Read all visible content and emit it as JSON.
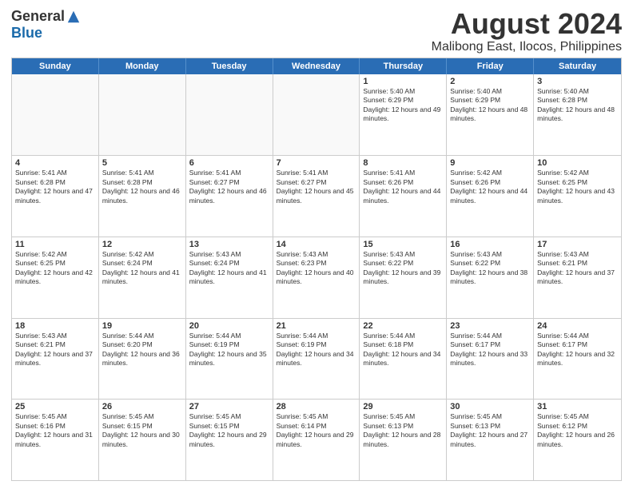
{
  "logo": {
    "general": "General",
    "blue": "Blue"
  },
  "title": "August 2024",
  "subtitle": "Malibong East, Ilocos, Philippines",
  "days": [
    "Sunday",
    "Monday",
    "Tuesday",
    "Wednesday",
    "Thursday",
    "Friday",
    "Saturday"
  ],
  "weeks": [
    [
      {
        "day": "",
        "text": "",
        "shaded": true
      },
      {
        "day": "",
        "text": "",
        "shaded": true
      },
      {
        "day": "",
        "text": "",
        "shaded": true
      },
      {
        "day": "",
        "text": "",
        "shaded": true
      },
      {
        "day": "1",
        "text": "Sunrise: 5:40 AM\nSunset: 6:29 PM\nDaylight: 12 hours and 49 minutes."
      },
      {
        "day": "2",
        "text": "Sunrise: 5:40 AM\nSunset: 6:29 PM\nDaylight: 12 hours and 48 minutes."
      },
      {
        "day": "3",
        "text": "Sunrise: 5:40 AM\nSunset: 6:28 PM\nDaylight: 12 hours and 48 minutes."
      }
    ],
    [
      {
        "day": "4",
        "text": "Sunrise: 5:41 AM\nSunset: 6:28 PM\nDaylight: 12 hours and 47 minutes."
      },
      {
        "day": "5",
        "text": "Sunrise: 5:41 AM\nSunset: 6:28 PM\nDaylight: 12 hours and 46 minutes."
      },
      {
        "day": "6",
        "text": "Sunrise: 5:41 AM\nSunset: 6:27 PM\nDaylight: 12 hours and 46 minutes."
      },
      {
        "day": "7",
        "text": "Sunrise: 5:41 AM\nSunset: 6:27 PM\nDaylight: 12 hours and 45 minutes."
      },
      {
        "day": "8",
        "text": "Sunrise: 5:41 AM\nSunset: 6:26 PM\nDaylight: 12 hours and 44 minutes."
      },
      {
        "day": "9",
        "text": "Sunrise: 5:42 AM\nSunset: 6:26 PM\nDaylight: 12 hours and 44 minutes."
      },
      {
        "day": "10",
        "text": "Sunrise: 5:42 AM\nSunset: 6:25 PM\nDaylight: 12 hours and 43 minutes."
      }
    ],
    [
      {
        "day": "11",
        "text": "Sunrise: 5:42 AM\nSunset: 6:25 PM\nDaylight: 12 hours and 42 minutes."
      },
      {
        "day": "12",
        "text": "Sunrise: 5:42 AM\nSunset: 6:24 PM\nDaylight: 12 hours and 41 minutes."
      },
      {
        "day": "13",
        "text": "Sunrise: 5:43 AM\nSunset: 6:24 PM\nDaylight: 12 hours and 41 minutes."
      },
      {
        "day": "14",
        "text": "Sunrise: 5:43 AM\nSunset: 6:23 PM\nDaylight: 12 hours and 40 minutes."
      },
      {
        "day": "15",
        "text": "Sunrise: 5:43 AM\nSunset: 6:22 PM\nDaylight: 12 hours and 39 minutes."
      },
      {
        "day": "16",
        "text": "Sunrise: 5:43 AM\nSunset: 6:22 PM\nDaylight: 12 hours and 38 minutes."
      },
      {
        "day": "17",
        "text": "Sunrise: 5:43 AM\nSunset: 6:21 PM\nDaylight: 12 hours and 37 minutes."
      }
    ],
    [
      {
        "day": "18",
        "text": "Sunrise: 5:43 AM\nSunset: 6:21 PM\nDaylight: 12 hours and 37 minutes."
      },
      {
        "day": "19",
        "text": "Sunrise: 5:44 AM\nSunset: 6:20 PM\nDaylight: 12 hours and 36 minutes."
      },
      {
        "day": "20",
        "text": "Sunrise: 5:44 AM\nSunset: 6:19 PM\nDaylight: 12 hours and 35 minutes."
      },
      {
        "day": "21",
        "text": "Sunrise: 5:44 AM\nSunset: 6:19 PM\nDaylight: 12 hours and 34 minutes."
      },
      {
        "day": "22",
        "text": "Sunrise: 5:44 AM\nSunset: 6:18 PM\nDaylight: 12 hours and 34 minutes."
      },
      {
        "day": "23",
        "text": "Sunrise: 5:44 AM\nSunset: 6:17 PM\nDaylight: 12 hours and 33 minutes."
      },
      {
        "day": "24",
        "text": "Sunrise: 5:44 AM\nSunset: 6:17 PM\nDaylight: 12 hours and 32 minutes."
      }
    ],
    [
      {
        "day": "25",
        "text": "Sunrise: 5:45 AM\nSunset: 6:16 PM\nDaylight: 12 hours and 31 minutes."
      },
      {
        "day": "26",
        "text": "Sunrise: 5:45 AM\nSunset: 6:15 PM\nDaylight: 12 hours and 30 minutes."
      },
      {
        "day": "27",
        "text": "Sunrise: 5:45 AM\nSunset: 6:15 PM\nDaylight: 12 hours and 29 minutes."
      },
      {
        "day": "28",
        "text": "Sunrise: 5:45 AM\nSunset: 6:14 PM\nDaylight: 12 hours and 29 minutes."
      },
      {
        "day": "29",
        "text": "Sunrise: 5:45 AM\nSunset: 6:13 PM\nDaylight: 12 hours and 28 minutes."
      },
      {
        "day": "30",
        "text": "Sunrise: 5:45 AM\nSunset: 6:13 PM\nDaylight: 12 hours and 27 minutes."
      },
      {
        "day": "31",
        "text": "Sunrise: 5:45 AM\nSunset: 6:12 PM\nDaylight: 12 hours and 26 minutes."
      }
    ]
  ]
}
